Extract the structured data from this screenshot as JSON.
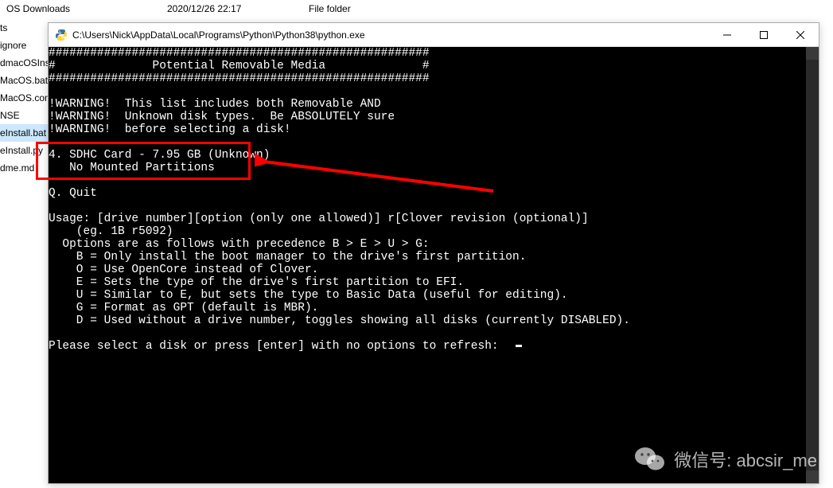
{
  "explorer": {
    "row_name": "OS Downloads",
    "row_date": "2020/12/26 22:17",
    "row_type": "File folder",
    "sidebar_items": [
      "ts",
      "ignore",
      "dmacOSInstall",
      "MacOS.bat",
      "MacOS.com",
      "NSE",
      "eInstall.bat",
      "eInstall.py",
      "dme.md"
    ]
  },
  "window": {
    "title": "C:\\Users\\Nick\\AppData\\Local\\Programs\\Python\\Python38\\python.exe"
  },
  "console": {
    "hash1": "#######################################################",
    "header": "#              Potential Removable Media              #",
    "hash2": "#######################################################",
    "warn1": "!WARNING!  This list includes both Removable AND",
    "warn2": "!WARNING!  Unknown disk types.  Be ABSOLUTELY sure",
    "warn3": "!WARNING!  before selecting a disk!",
    "disk_line": "4. SDHC Card - 7.95 GB (Unknown)",
    "disk_sub": "   No Mounted Partitions",
    "quit": "Q. Quit",
    "usage": "Usage: [drive number][option (only one allowed)] r[Clover revision (optional)]",
    "usage_eg": "    (eg. 1B r5092)",
    "opts_head": "  Options are as follows with precedence B > E > U > G:",
    "opt_b": "    B = Only install the boot manager to the drive's first partition.",
    "opt_o": "    O = Use OpenCore instead of Clover.",
    "opt_e": "    E = Sets the type of the drive's first partition to EFI.",
    "opt_u": "    U = Similar to E, but sets the type to Basic Data (useful for editing).",
    "opt_g": "    G = Format as GPT (default is MBR).",
    "opt_d": "    D = Used without a drive number, toggles showing all disks (currently DISABLED).",
    "prompt": "Please select a disk or press [enter] with no options to refresh:  "
  },
  "watermark": {
    "label": "微信号: abcsir_me"
  }
}
